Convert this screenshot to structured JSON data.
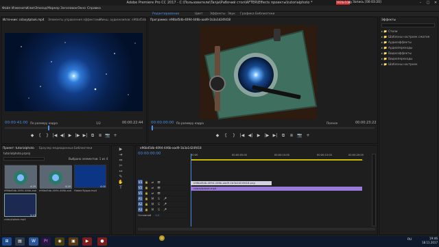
{
  "title_bar": {
    "title": "Adobe Premiere Pro CC 2017 - C:\\Пользователи\\Tanja\\Рабочий стол\\AFTER\\Effects проекты\\tutorialphoto *",
    "resolution": "1920x1080",
    "record_status": "Запись [00:03:20]",
    "minimize": "–",
    "maximize": "□",
    "close": "✕"
  },
  "menu": [
    "Файл",
    "Изменить",
    "Клип",
    "Эпизод",
    "Маркер",
    "Заголовок",
    "Окно",
    "Справка"
  ],
  "workspaces": [
    "Редактирование",
    "Цвет",
    "Эффекты",
    "Звук",
    "Графика",
    "Библиотеки"
  ],
  "source": {
    "tabs": [
      "Источник: cslaxytplaxk.mp4",
      "Элементы управления эффектами",
      "Микш. аудиоклипов: e96bd5db"
    ],
    "timecode": "00:00:41:00",
    "fit": "По размеру кадра",
    "zoom": "1/2",
    "end_timecode": "00:00:22:44",
    "controls": [
      "◆",
      "{",
      "}",
      "|◀",
      "◀|",
      "▶",
      "|▶",
      "▶|",
      "⧉",
      "⧈",
      "📷",
      "+"
    ]
  },
  "program": {
    "tab": "Программа: e96bd5db-4094-446b-aad9-1b3a1d24fd18",
    "timecode": "00:00:00:00",
    "fit": "По размеру кадра",
    "zoom": "Полное",
    "end_timecode": "00:00:23:22",
    "controls": [
      "◆",
      "{",
      "}",
      "|◀",
      "◀|",
      "▶",
      "|▶",
      "▶|",
      "⧉",
      "⧈",
      "📷",
      "+"
    ]
  },
  "project": {
    "tabs": [
      "Проект: tutorialphoto",
      "Браузер медиаданных",
      "Библиотеки"
    ],
    "path": "tutorialphoto.prproj",
    "selection": "Выбрано элементов: 1 из 4",
    "items": [
      {
        "label": "e96bd5db-4094-446b-aad9...",
        "duration": "4:29"
      },
      {
        "label": "e96bd5db-4094-446b-aad9...",
        "duration": "4:29"
      },
      {
        "label": "Новая бурда.mp4",
        "duration": "4:00"
      },
      {
        "label": "cslaxytplaxk.mp4",
        "duration": "5:13"
      }
    ]
  },
  "timeline": {
    "tab": "e96bd5db-4094-446b-aad9-1b3a1d24fd18",
    "timecode": "00:00:00:00",
    "ticks": [
      "00:00",
      "00:00:05:00",
      "00:00:10:00",
      "00:00:15:00",
      "00:00:20:00"
    ],
    "tracks": [
      "V3",
      "V2",
      "V1",
      "A1",
      "A2",
      "A3"
    ],
    "track_buttons": {
      "lock": "🔒",
      "sync": "⇄",
      "eye": "👁",
      "mute": "M",
      "solo": "S",
      "mic": "🎤"
    },
    "master": {
      "label": "Основной",
      "value": "0,0"
    },
    "clips": [
      {
        "name": "e96bd5db-4094-446b-aad9-1b3a1d24fd18.png"
      },
      {
        "name": "cslaxytplaxk.mp4"
      }
    ]
  },
  "effects": {
    "tab": "Эффекты",
    "items": [
      "Стили",
      "Шаблоны настроек сжатия",
      "Аудиоэффекты",
      "Аудиопереходы",
      "Видеоэффекты",
      "Видеопереходы",
      "Шаблоны настроек"
    ]
  },
  "tools": [
    "▶",
    "⇥",
    "⇔",
    "✂",
    "↔",
    "✎",
    "✋",
    "T"
  ],
  "taskbar": {
    "time": "19:46",
    "date": "18.11.2017",
    "lang": "RU"
  },
  "colors": {
    "accent": "#4a8fe8",
    "clip_video": "#9b7bd8",
    "clip_still": "#d4d1e0"
  }
}
